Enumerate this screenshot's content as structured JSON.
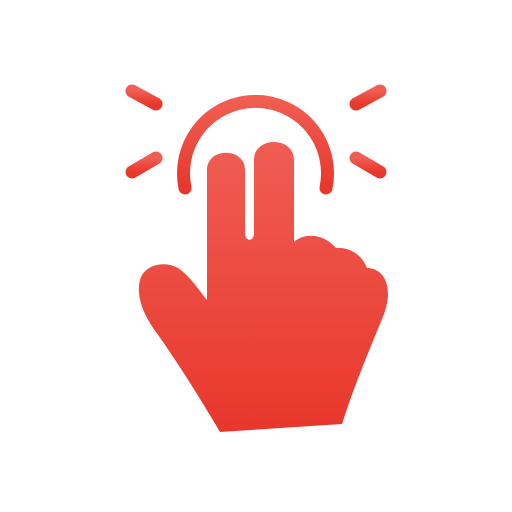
{
  "icon": {
    "name": "two-finger-tap-icon",
    "colors": {
      "top": "#F05D52",
      "bottom": "#E8372C"
    },
    "background": "#ffffff"
  }
}
